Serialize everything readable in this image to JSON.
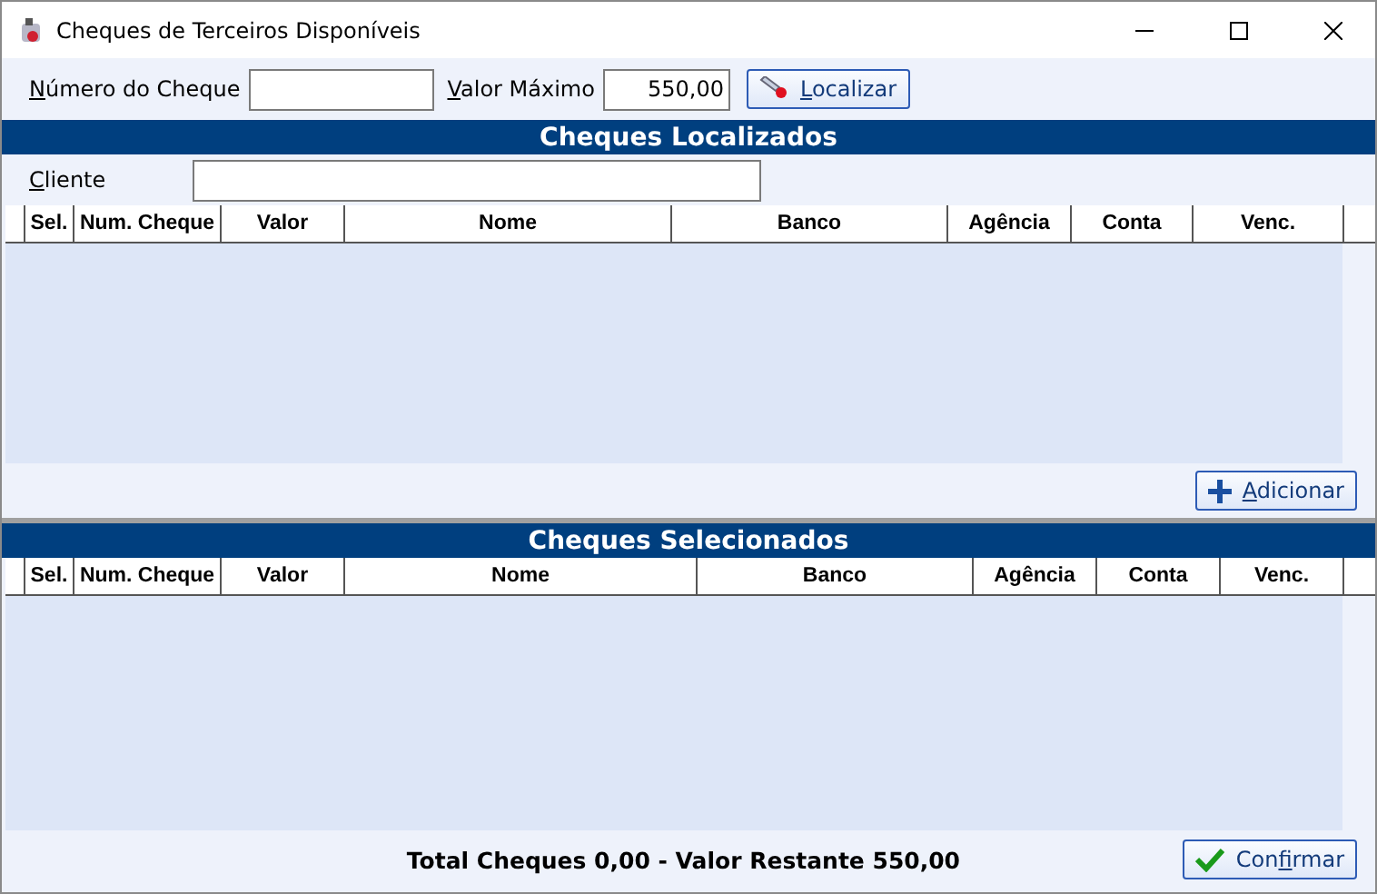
{
  "window": {
    "title": "Cheques de Terceiros Disponíveis"
  },
  "search": {
    "numero": {
      "label": {
        "key": "N",
        "after": "úmero do Cheque"
      }
    },
    "valor": {
      "label": {
        "key": "V",
        "after": "alor Máximo"
      },
      "value": "550,00"
    },
    "button": {
      "label": {
        "key": "L",
        "after": "ocalizar"
      }
    }
  },
  "found": {
    "title": "Cheques Localizados",
    "client": {
      "label": {
        "key": "C",
        "after": "liente"
      }
    },
    "columns": [
      "Sel.",
      "Num. Cheque",
      "Valor",
      "Nome",
      "Banco",
      "Agência",
      "Conta",
      "Venc."
    ],
    "button": {
      "label": {
        "key": "A",
        "after": "dicionar"
      }
    }
  },
  "selected": {
    "title": "Cheques Selecionados",
    "columns": [
      "Sel.",
      "Num. Cheque",
      "Valor",
      "Nome",
      "Banco",
      "Agência",
      "Conta",
      "Venc."
    ],
    "total": "Total Cheques 0,00 - Valor Restante 550,00",
    "button": {
      "label": {
        "before": "Con",
        "key": "f",
        "after": "irmar"
      }
    }
  }
}
